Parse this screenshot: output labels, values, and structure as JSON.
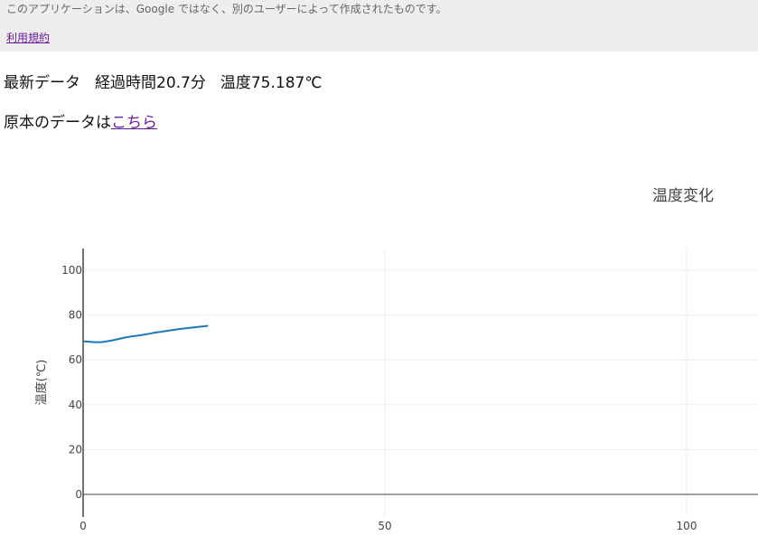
{
  "banner": {
    "notice": "このアプリケーションは、Google ではなく、別のユーザーによって作成されたものです。",
    "terms_link": "利用規約"
  },
  "latest": {
    "label": "最新データ",
    "elapsed": "経過時間20.7分",
    "temperature": "温度75.187℃"
  },
  "original": {
    "prefix": "原本のデータは",
    "link": "こちら"
  },
  "chart_data": {
    "type": "line",
    "title": "温度変化",
    "xlabel": "",
    "ylabel": "温度(℃)",
    "xlim": [
      0,
      110
    ],
    "ylim": [
      -10,
      110
    ],
    "xticks": [
      0,
      50,
      100
    ],
    "yticks": [
      0,
      20,
      40,
      60,
      80,
      100
    ],
    "grid": true,
    "line_color": "#1f77b4",
    "series": [
      {
        "x": [
          0,
          1,
          2,
          3,
          4,
          5,
          6,
          7,
          8,
          9,
          10,
          11,
          12,
          13,
          14,
          15,
          16,
          17,
          18,
          19,
          20,
          20.7
        ],
        "values": [
          68.3,
          68.1,
          67.9,
          67.9,
          68.3,
          68.8,
          69.4,
          70.0,
          70.5,
          70.8,
          71.2,
          71.7,
          72.2,
          72.6,
          73.0,
          73.4,
          73.8,
          74.1,
          74.4,
          74.7,
          75.0,
          75.187
        ]
      }
    ]
  }
}
